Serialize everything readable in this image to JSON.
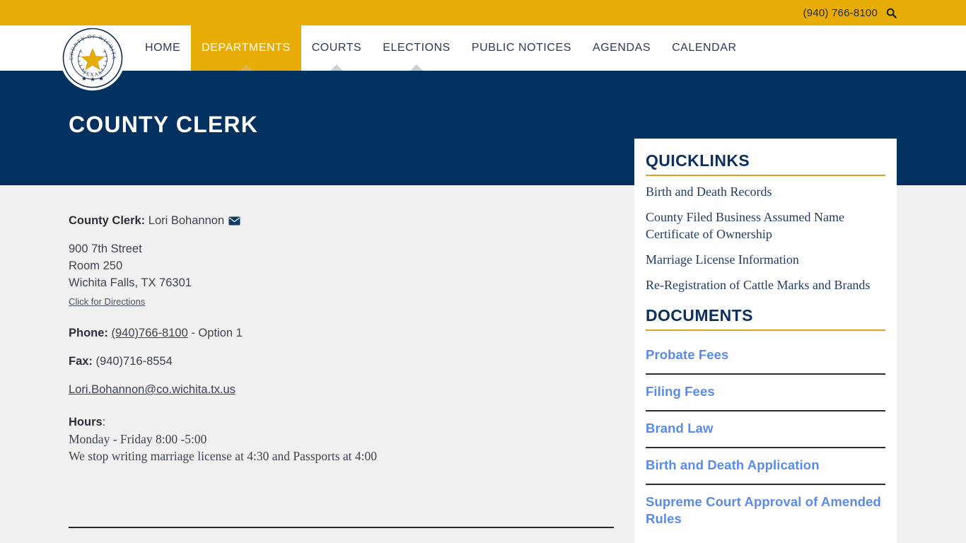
{
  "topbar": {
    "phone": "(940) 766-8100",
    "search_icon": "search-icon"
  },
  "brand": {
    "seal_alt": "County of Wichita Texas seal",
    "seal_text_top": "COUNTY OF WICHITA",
    "seal_text_bottom": "TEXAS"
  },
  "nav": {
    "items": [
      {
        "label": "HOME",
        "active": false,
        "caret": false
      },
      {
        "label": "DEPARTMENTS",
        "active": true,
        "caret": true
      },
      {
        "label": "COURTS",
        "active": false,
        "caret": true
      },
      {
        "label": "ELECTIONS",
        "active": false,
        "caret": true
      },
      {
        "label": "PUBLIC NOTICES",
        "active": false,
        "caret": false
      },
      {
        "label": "AGENDAS",
        "active": false,
        "caret": false
      },
      {
        "label": "CALENDAR",
        "active": false,
        "caret": false
      }
    ]
  },
  "hero": {
    "title": "COUNTY CLERK"
  },
  "contact": {
    "clerk_label": "County Clerk:",
    "clerk_name": "Lori Bohannon",
    "email_icon": "envelope-icon",
    "address_line1": "900 7th Street",
    "address_line2": "Room 250",
    "address_line3": "Wichita Falls, TX 76301",
    "directions_link": "Click for Directions",
    "phone_label": "Phone:",
    "phone_number": "(940)766-8100",
    "phone_suffix": " - Option 1",
    "fax_label": "Fax:",
    "fax_number": "(940)716-8554",
    "email": "Lori.Bohannon@co.wichita.tx.us",
    "hours_label": "Hours",
    "hours_colon": ":",
    "hours_line1": "Monday - Friday 8:00 -5:00",
    "hours_line2": "We stop writing marriage license at 4:30 and Passports at 4:00"
  },
  "sidebar": {
    "quicklinks_title": "QUICKLINKS",
    "quicklinks": [
      "Birth and Death Records",
      "County Filed Business Assumed Name Certificate of Ownership",
      "Marriage License Information",
      "Re-Registration of Cattle Marks and Brands"
    ],
    "documents_title": "DOCUMENTS",
    "documents": [
      "Probate Fees",
      "Filing Fees",
      "Brand Law",
      "Birth and Death Application",
      "Supreme Court Approval of Amended Rules"
    ]
  },
  "colors": {
    "gold": "#e8ac06",
    "navy": "#033160",
    "panel_heading": "#0b2f5e",
    "doc_link_blue": "#5b8be8",
    "page_bg": "#f0f0f0",
    "rule_gold": "#d8a621"
  }
}
